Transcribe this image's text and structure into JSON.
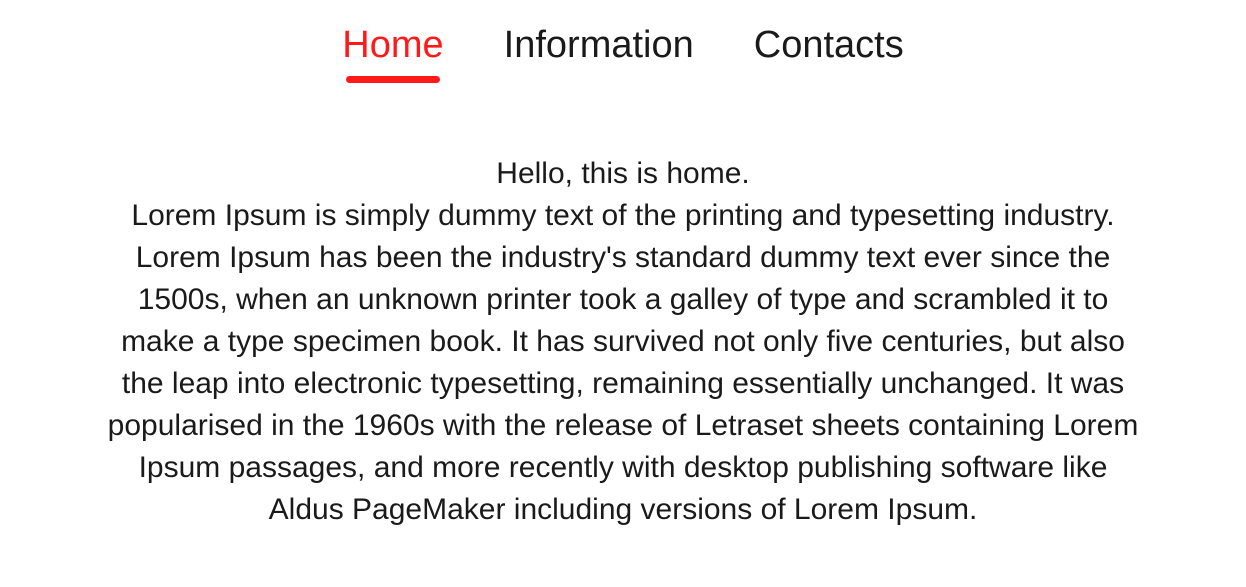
{
  "nav": {
    "items": [
      {
        "label": "Home",
        "active": true
      },
      {
        "label": "Information",
        "active": false
      },
      {
        "label": "Contacts",
        "active": false
      }
    ]
  },
  "content": {
    "greeting": "Hello, this is home.",
    "body": "Lorem Ipsum is simply dummy text of the printing and typesetting industry. Lorem Ipsum has been the industry's standard dummy text ever since the 1500s, when an unknown printer took a galley of type and scrambled it to make a type specimen book. It has survived not only five centuries, but also the leap into electronic typesetting, remaining essentially unchanged. It was popularised in the 1960s with the release of Letraset sheets containing Lorem Ipsum passages, and more recently with desktop publishing software like Aldus PageMaker including versions of Lorem Ipsum."
  }
}
